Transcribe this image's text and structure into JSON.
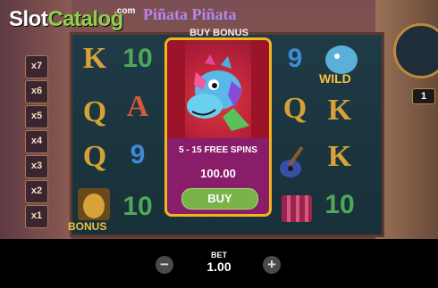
{
  "logo": {
    "part1": "Slot",
    "part2": "Catalog",
    "suffix": ".com"
  },
  "game_title": "Piñata Piñata",
  "multipliers": [
    "x7",
    "x6",
    "x5",
    "x4",
    "x3",
    "x2",
    "x1"
  ],
  "reel_symbols": {
    "col1": [
      "K",
      "Q",
      "Q"
    ],
    "col2": [
      "10",
      "A",
      "9",
      "10"
    ],
    "col4": [
      "9",
      "Q",
      "10"
    ],
    "col5": [
      "K",
      "K",
      "10"
    ]
  },
  "wild_label": "WILD",
  "bonus_label": "BONUS",
  "counter_value": "1",
  "buy_bonus": {
    "title": "BUY BONUS",
    "description": "5 - 15 FREE SPINS",
    "price": "100.00",
    "button_label": "BUY"
  },
  "bet": {
    "label": "BET",
    "value": "1.00",
    "decrease_icon": "minus-icon",
    "increase_icon": "plus-icon"
  },
  "colors": {
    "card_border": "#f1b51c",
    "card_bg": "#8a1d6a",
    "buy_button": "#79b34a"
  }
}
